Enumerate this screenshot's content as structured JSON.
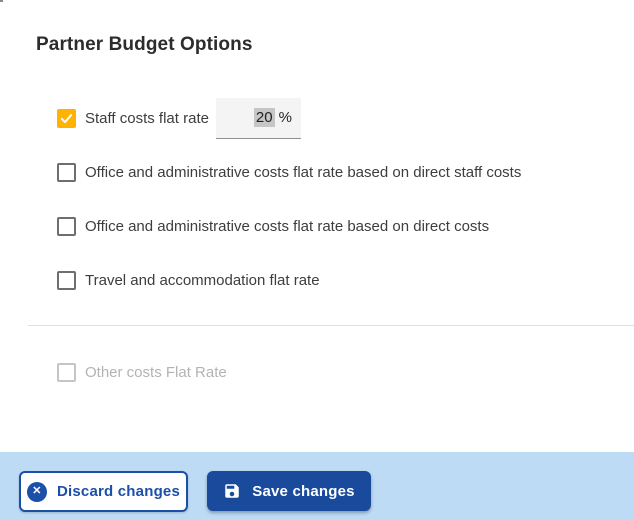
{
  "page": {
    "title": "Partner Budget Options"
  },
  "options": [
    {
      "label": "Staff costs flat rate",
      "checked": true,
      "disabled": false,
      "rate_value": "20",
      "rate_unit": "%"
    },
    {
      "label": "Office and administrative costs flat rate based on direct staff costs",
      "checked": false,
      "disabled": false
    },
    {
      "label": "Office and administrative costs flat rate based on direct costs",
      "checked": false,
      "disabled": false
    },
    {
      "label": "Travel and accommodation flat rate",
      "checked": false,
      "disabled": false
    },
    {
      "label": "Other costs Flat Rate",
      "checked": false,
      "disabled": true
    }
  ],
  "footer": {
    "discard_label": "Discard changes",
    "save_label": "Save changes",
    "cancel_icon_glyph": "✕"
  },
  "colors": {
    "checked_checkbox": "#FFB300",
    "primary_blue": "#1B4FA8",
    "save_button_fill": "#194A9B",
    "footer_bar": "#BDDBF5",
    "field_background": "#F4F4F4",
    "selection_highlight": "#C6C6C6",
    "disabled_gray": "#B3B3B3"
  }
}
